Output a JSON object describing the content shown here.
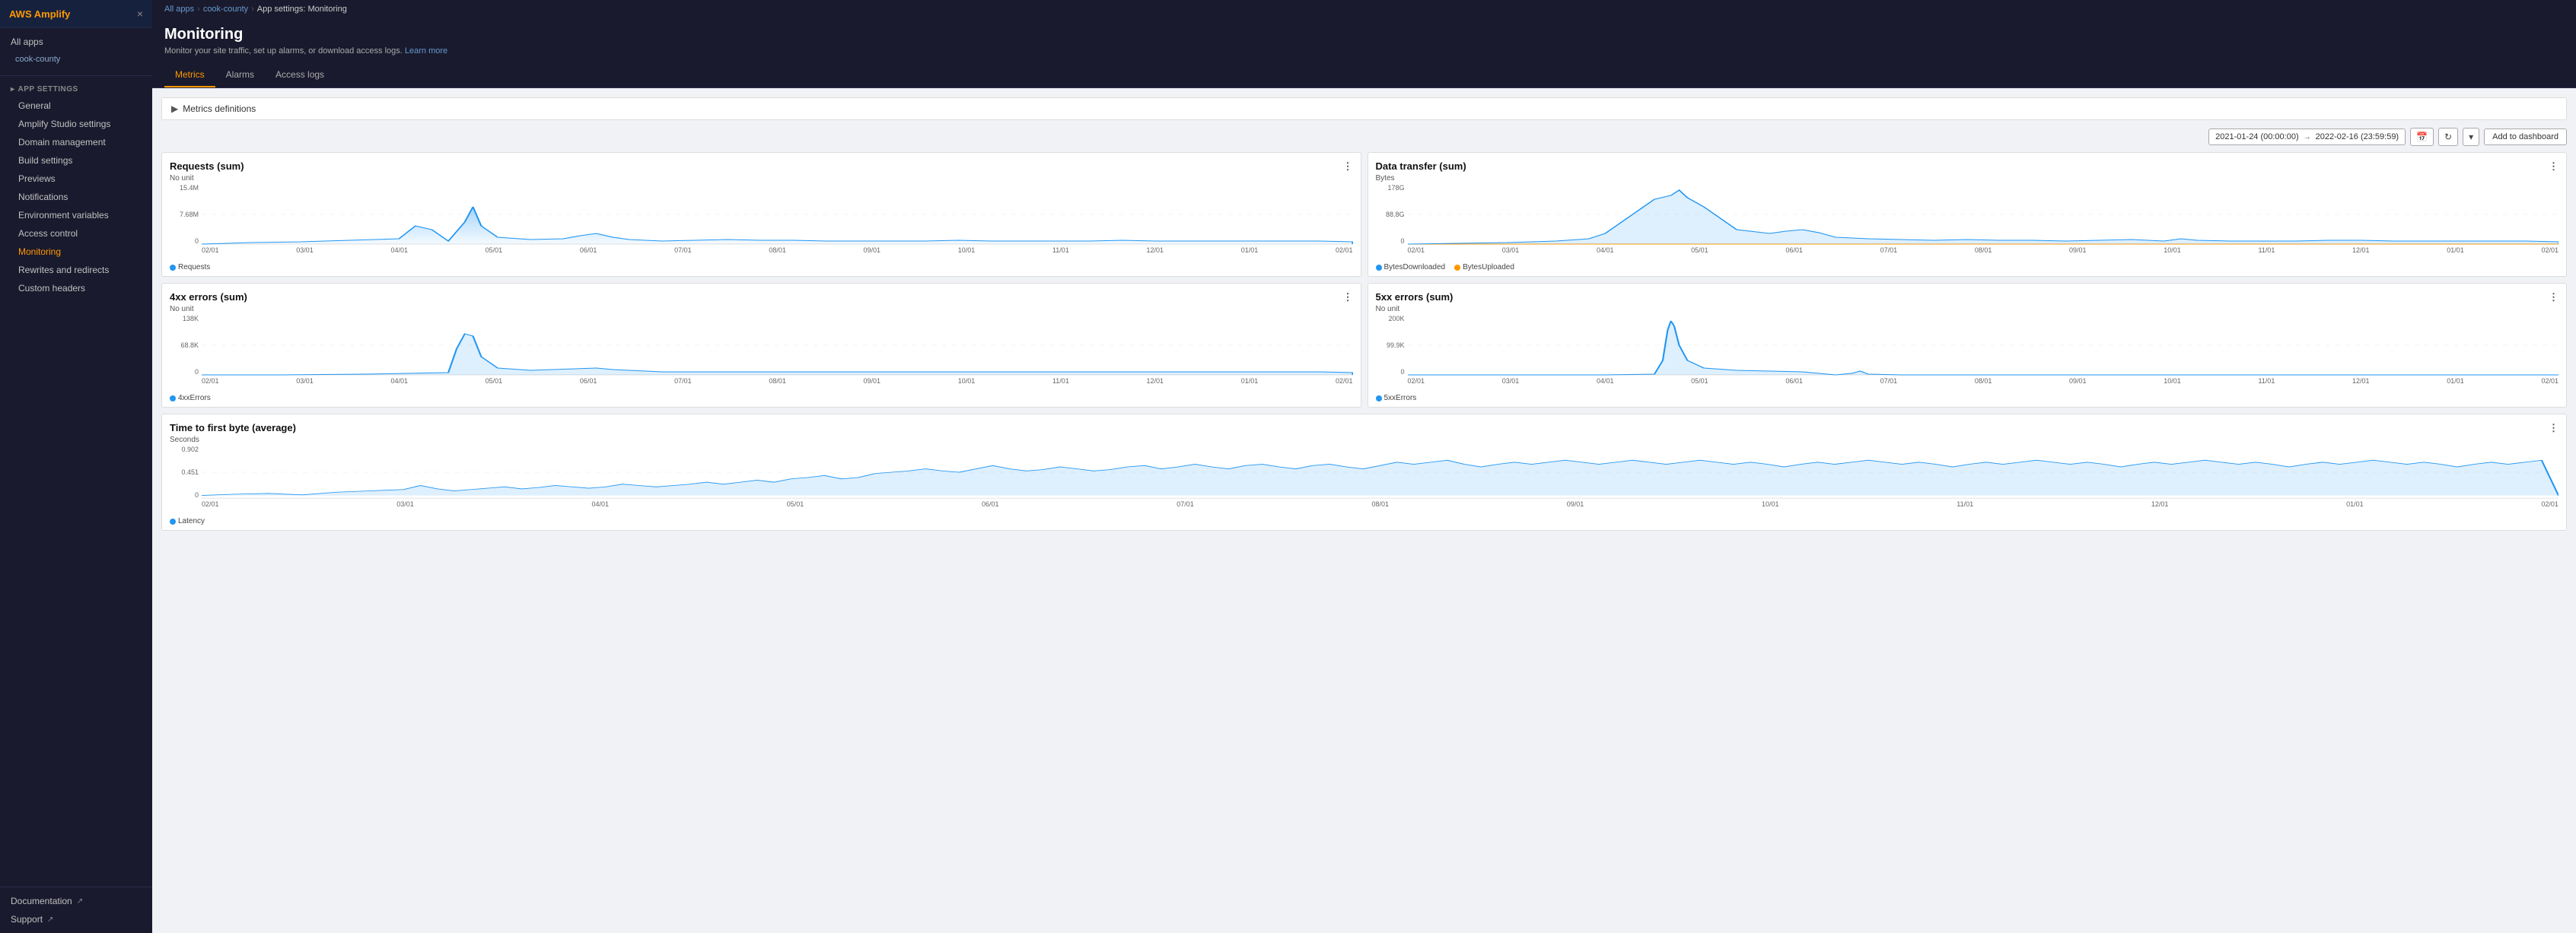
{
  "brand": "AWS Amplify",
  "sidebar": {
    "close_label": "×",
    "all_apps_label": "All apps",
    "app_name": "cook-county",
    "app_settings_label": "App settings",
    "arrow": "▸",
    "items": [
      {
        "id": "general",
        "label": "General",
        "sub": false
      },
      {
        "id": "amplify-studio-settings",
        "label": "Amplify Studio settings",
        "sub": false
      },
      {
        "id": "domain-management",
        "label": "Domain management",
        "sub": false
      },
      {
        "id": "build-settings",
        "label": "Build settings",
        "sub": false
      },
      {
        "id": "previews",
        "label": "Previews",
        "sub": false
      },
      {
        "id": "notifications",
        "label": "Notifications",
        "sub": false
      },
      {
        "id": "environment-variables",
        "label": "Environment variables",
        "sub": false
      },
      {
        "id": "access-control",
        "label": "Access control",
        "sub": false
      },
      {
        "id": "monitoring",
        "label": "Monitoring",
        "sub": false,
        "active": true
      },
      {
        "id": "rewrites-and-redirects",
        "label": "Rewrites and redirects",
        "sub": false
      },
      {
        "id": "custom-headers",
        "label": "Custom headers",
        "sub": false
      }
    ],
    "bottom_items": [
      {
        "id": "documentation",
        "label": "Documentation",
        "external": true
      },
      {
        "id": "support",
        "label": "Support",
        "external": true
      }
    ]
  },
  "breadcrumb": {
    "all_apps": "All apps",
    "app": "cook-county",
    "current": "App settings: Monitoring"
  },
  "page": {
    "title": "Monitoring",
    "subtitle": "Monitor your site traffic, set up alarms, or download access logs.",
    "learn_more": "Learn more"
  },
  "tabs": [
    {
      "id": "metrics",
      "label": "Metrics",
      "active": true
    },
    {
      "id": "alarms",
      "label": "Alarms"
    },
    {
      "id": "access-logs",
      "label": "Access logs"
    }
  ],
  "metrics_definitions_label": "Metrics definitions",
  "toolbar": {
    "date_start": "2021-01-24 (00:00:00)",
    "date_end": "2022-02-16 (23:59:59)",
    "add_dashboard_label": "Add to dashboard"
  },
  "charts": {
    "requests": {
      "title": "Requests (sum)",
      "unit": "No unit",
      "y_max": "15.4M",
      "y_mid": "7.68M",
      "y_zero": "0",
      "legend": [
        {
          "label": "Requests",
          "color": "blue"
        }
      ],
      "x_labels": [
        "02/01",
        "03/01",
        "04/01",
        "05/01",
        "06/01",
        "07/01",
        "08/01",
        "09/01",
        "10/01",
        "11/01",
        "12/01",
        "01/01",
        "02/01"
      ]
    },
    "data_transfer": {
      "title": "Data transfer (sum)",
      "unit": "Bytes",
      "y_max": "178G",
      "y_mid": "88.8G",
      "y_zero": "0",
      "legend": [
        {
          "label": "BytesDownloaded",
          "color": "blue"
        },
        {
          "label": "BytesUploaded",
          "color": "orange"
        }
      ],
      "x_labels": [
        "02/01",
        "03/01",
        "04/01",
        "05/01",
        "06/01",
        "07/01",
        "08/01",
        "09/01",
        "10/01",
        "11/01",
        "12/01",
        "01/01",
        "02/01"
      ]
    },
    "errors_4xx": {
      "title": "4xx errors (sum)",
      "unit": "No unit",
      "y_max": "138K",
      "y_mid": "68.8K",
      "y_zero": "0",
      "legend": [
        {
          "label": "4xxErrors",
          "color": "blue"
        }
      ],
      "x_labels": [
        "02/01",
        "03/01",
        "04/01",
        "05/01",
        "06/01",
        "07/01",
        "08/01",
        "09/01",
        "10/01",
        "11/01",
        "12/01",
        "01/01",
        "02/01"
      ]
    },
    "errors_5xx": {
      "title": "5xx errors (sum)",
      "unit": "No unit",
      "y_max": "200K",
      "y_mid": "99.9K",
      "y_zero": "0",
      "legend": [
        {
          "label": "5xxErrors",
          "color": "blue"
        }
      ],
      "x_labels": [
        "02/01",
        "03/01",
        "04/01",
        "05/01",
        "06/01",
        "07/01",
        "08/01",
        "09/01",
        "10/01",
        "11/01",
        "12/01",
        "01/01",
        "02/01"
      ]
    },
    "ttfb": {
      "title": "Time to first byte (average)",
      "unit": "Seconds",
      "y_max": "0.902",
      "y_mid": "0.451",
      "y_zero": "0",
      "legend": [
        {
          "label": "Latency",
          "color": "blue"
        }
      ],
      "x_labels": [
        "02/01",
        "03/01",
        "04/01",
        "05/01",
        "06/01",
        "07/01",
        "08/01",
        "09/01",
        "10/01",
        "11/01",
        "12/01",
        "01/01",
        "02/01"
      ]
    }
  }
}
